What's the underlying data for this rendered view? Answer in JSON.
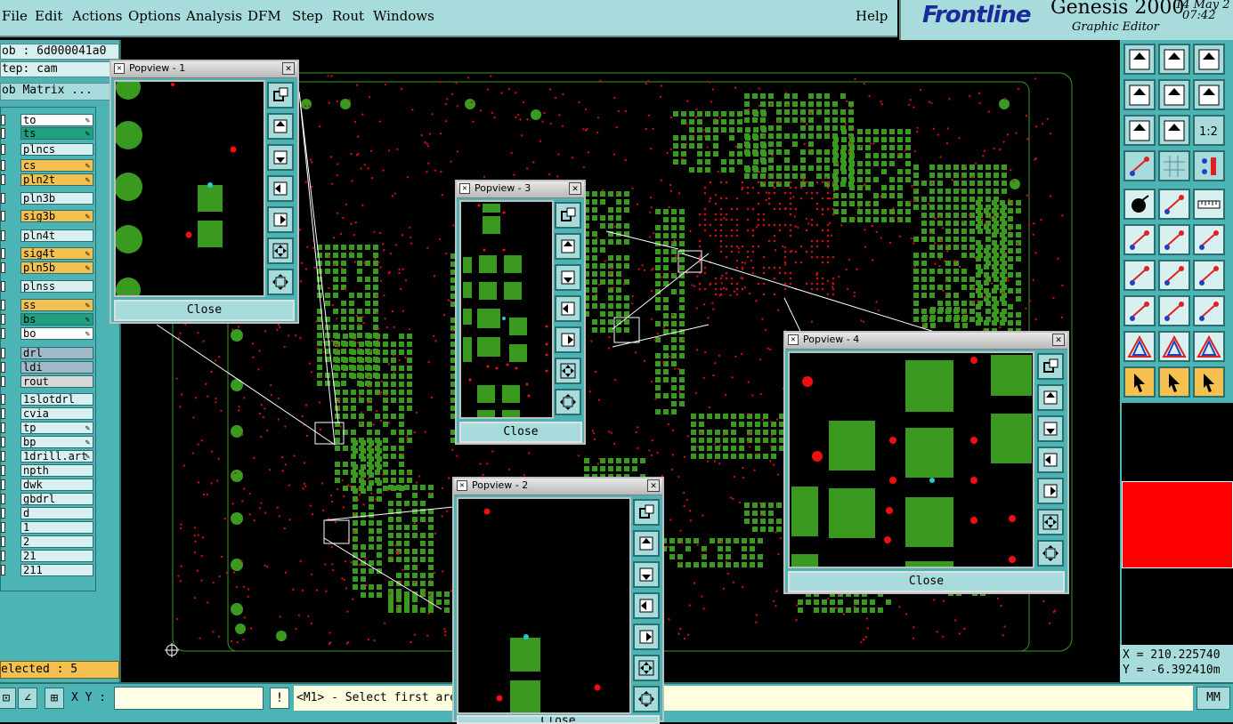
{
  "menu": {
    "items": [
      "File",
      "Edit",
      "Actions",
      "Options",
      "Analysis",
      "DFM",
      "Step",
      "Rout",
      "Windows"
    ],
    "help": "Help"
  },
  "brand": {
    "logo": "Frontline",
    "product": "Genesis 2000",
    "subtitle": "Graphic Editor",
    "date": "14 May 2",
    "time": "07:42"
  },
  "job": {
    "job_label": "ob : 6d000041a0",
    "step_label": "tep: cam",
    "matrix_button": "ob Matrix ..."
  },
  "layers": [
    {
      "name": "to",
      "color": "#ffffff",
      "editable": true
    },
    {
      "name": "ts",
      "color": "#20a080",
      "editable": true
    },
    {
      "name": "plncs",
      "color": "#d8f0f0",
      "editable": false
    },
    {
      "name": "cs",
      "color": "#f4c050",
      "editable": true
    },
    {
      "name": "pln2t",
      "color": "#f4c050",
      "editable": true
    },
    {
      "name": "pln3b",
      "color": "#d8f0f0",
      "editable": false
    },
    {
      "name": "sig3b",
      "color": "#f4c050",
      "editable": true
    },
    {
      "name": "pln4t",
      "color": "#d8f0f0",
      "editable": false
    },
    {
      "name": "sig4t",
      "color": "#f4c050",
      "editable": true
    },
    {
      "name": "pln5b",
      "color": "#f4c050",
      "editable": true
    },
    {
      "name": "plnss",
      "color": "#d8f0f0",
      "editable": false
    },
    {
      "name": "ss",
      "color": "#f4c050",
      "editable": true
    },
    {
      "name": "bs",
      "color": "#20a080",
      "editable": true
    },
    {
      "name": "bo",
      "color": "#ffffff",
      "editable": true
    },
    {
      "name": "drl",
      "color": "#a0b8c8",
      "editable": false
    },
    {
      "name": "ldi",
      "color": "#a0b8c8",
      "editable": false
    },
    {
      "name": "rout",
      "color": "#d8d8d8",
      "editable": false
    },
    {
      "name": "1slotdrl",
      "color": "#d8f0f0",
      "editable": false
    },
    {
      "name": "cvia",
      "color": "#d8f0f0",
      "editable": false
    },
    {
      "name": "tp",
      "color": "#d8f0f0",
      "editable": true
    },
    {
      "name": "bp",
      "color": "#d8f0f0",
      "editable": true
    },
    {
      "name": "1drill.art",
      "color": "#d8f0f0",
      "editable": true
    },
    {
      "name": "npth",
      "color": "#d8f0f0",
      "editable": false
    },
    {
      "name": "dwk",
      "color": "#d8f0f0",
      "editable": false
    },
    {
      "name": "gbdrl",
      "color": "#d8f0f0",
      "editable": false
    },
    {
      "name": "d",
      "color": "#d8f0f0",
      "editable": false
    },
    {
      "name": "1",
      "color": "#d8f0f0",
      "editable": false
    },
    {
      "name": "2",
      "color": "#d8f0f0",
      "editable": false
    },
    {
      "name": "21",
      "color": "#d8f0f0",
      "editable": false
    },
    {
      "name": "211",
      "color": "#d8f0f0",
      "editable": false
    }
  ],
  "status": {
    "selected": "elected : 5",
    "xy_label": "X Y :",
    "xy_value": "",
    "message": "<M1> - Select first area",
    "units": "MM",
    "coord_x": "X = 210.225740",
    "coord_y": "Y = -6.392410m"
  },
  "popviews": [
    {
      "title": "Popview - 1",
      "close": "Close"
    },
    {
      "title": "Popview - 3",
      "close": "Close"
    },
    {
      "title": "Popview - 2",
      "close": "Close"
    },
    {
      "title": "Popview - 4",
      "close": "Close"
    }
  ],
  "colors": {
    "panel": "#4cb4b4",
    "light": "#a8dcdc",
    "pad": "#3a9a20",
    "drill": "#cc1010",
    "highlight": "#ff0000"
  }
}
